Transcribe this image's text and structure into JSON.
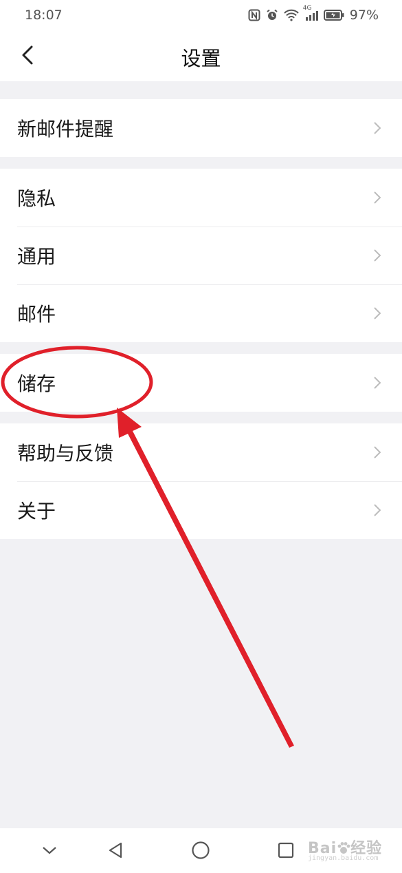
{
  "status_bar": {
    "time": "18:07",
    "network": "4G",
    "battery": "97%"
  },
  "header": {
    "title": "设置",
    "back_icon": "chevron-left-icon"
  },
  "settings": {
    "group1": [
      {
        "label": "新邮件提醒"
      }
    ],
    "group2": [
      {
        "label": "隐私"
      },
      {
        "label": "通用"
      },
      {
        "label": "邮件"
      }
    ],
    "group3": [
      {
        "label": "储存"
      }
    ],
    "group4": [
      {
        "label": "帮助与反馈"
      },
      {
        "label": "关于"
      }
    ]
  },
  "bottom_nav": {
    "icons": [
      "chevron-down-icon",
      "back-triangle-icon",
      "home-circle-icon",
      "recents-square-icon"
    ]
  },
  "watermark": {
    "brand": "Bai",
    "suffix": "经验",
    "url": "jingyan.baidu.com"
  },
  "colors": {
    "page_background": "#f1f1f4",
    "row_background": "#ffffff",
    "chevron": "#bcbcbc",
    "annotation_red": "#e0202a"
  }
}
